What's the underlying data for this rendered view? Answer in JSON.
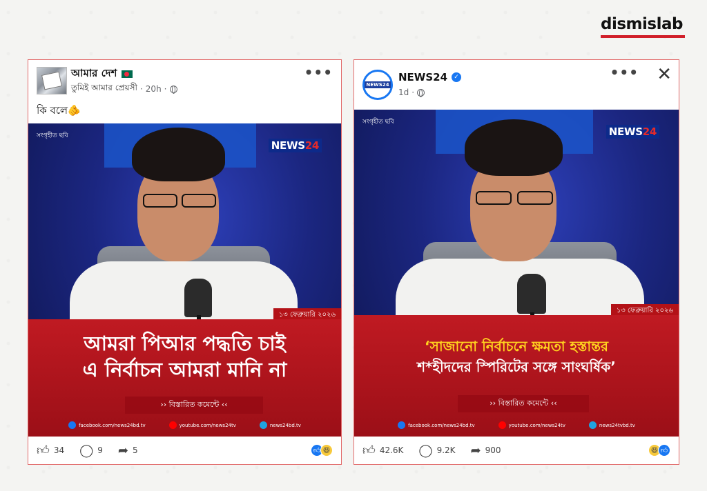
{
  "brand": {
    "name": "dismislab",
    "accent": "#d11f2a"
  },
  "left_post": {
    "page_name": "আমার দেশ",
    "author": "তুমিই আমার প্রেয়সী",
    "time": "20h",
    "caption": "কি বলে🫵",
    "image": {
      "sourced_label": "সংগৃহীত ছবি",
      "logo_main": "NEWS",
      "logo_num": "24",
      "date": "১৩ ফেব্রুয়ারি ২০২৬",
      "headline_line1": "আমরা পিআর পদ্ধতি চাই",
      "headline_line2": "এ নির্বাচন আমরা মানি না",
      "details": "›› বিস্তারিত কমেন্টে ‹‹",
      "socials": [
        "facebook.com/news24bd.tv",
        "youtube.com/news24tv",
        "news24bd.tv"
      ]
    },
    "stats": {
      "likes": "34",
      "comments": "9",
      "shares": "5"
    }
  },
  "right_post": {
    "page_name": "NEWS24",
    "time": "1d",
    "image": {
      "sourced_label": "সংগৃহীত ছবি",
      "logo_main": "NEWS",
      "logo_num": "24",
      "date": "১৩ ফেব্রুয়ারি ২০২৬",
      "headline_line1": "‘সাজানো নির্বাচনে ক্ষমতা হস্তান্তর",
      "headline_line2": "শ*হীদদের স্পিরিটের সঙ্গে সাংঘর্ষিক’",
      "details": "›› বিস্তারিত কমেন্টে ‹‹",
      "socials": [
        "facebook.com/news24bd.tv",
        "youtube.com/news24tv",
        "news24tvbd.tv"
      ]
    },
    "stats": {
      "likes": "42.6K",
      "comments": "9.2K",
      "shares": "900"
    }
  }
}
